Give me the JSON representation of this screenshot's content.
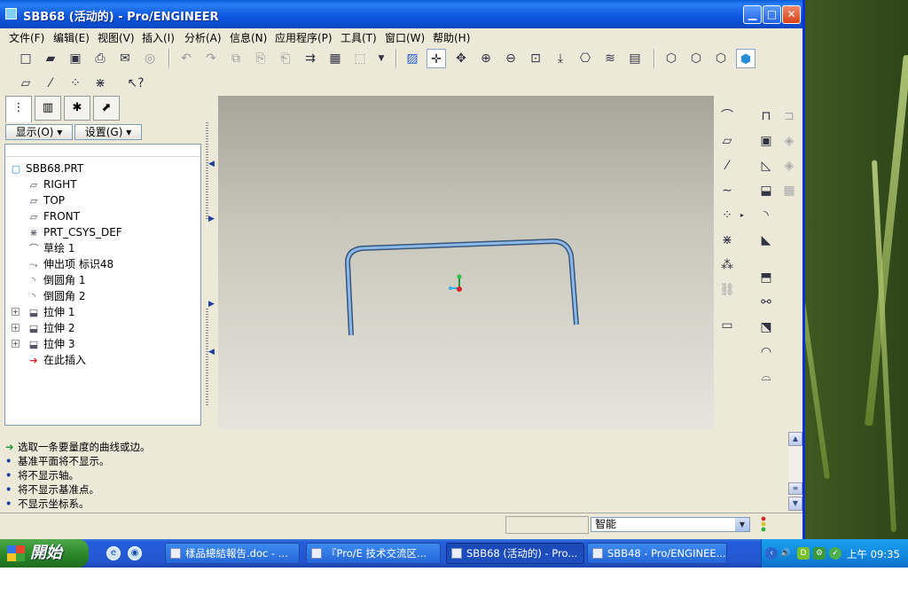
{
  "window": {
    "title": "SBB68 (活动的) - Pro/ENGINEER",
    "minimize": "▁",
    "maximize": "□",
    "close": "✕"
  },
  "menu": [
    "文件(F)",
    "编辑(E)",
    "视图(V)",
    "插入(I)",
    "分析(A)",
    "信息(N)",
    "应用程序(P)",
    "工具(T)",
    "窗口(W)",
    "帮助(H)"
  ],
  "toolbar1_icons": [
    "new-icon",
    "open-icon",
    "save-icon",
    "print-icon",
    "send-icon",
    "disk-icon",
    "undo-icon",
    "redo-icon",
    "copy-icon",
    "paste-icon",
    "paste-special-icon",
    "regenerate-icon",
    "find-icon",
    "select-box-icon",
    "dropdown-icon",
    "repaint-icon",
    "spin-center-icon",
    "orient-icon",
    "zoom-in-icon",
    "zoom-out-icon",
    "refit-icon",
    "reorient-icon",
    "saved-views-icon",
    "layers-icon",
    "view-manager-icon",
    "wireframe-icon",
    "hidden-line-icon",
    "no-hidden-icon",
    "shading-icon"
  ],
  "toolbar2_icons": [
    "datum-plane-display-icon",
    "datum-axis-display-icon",
    "datum-point-display-icon",
    "csys-display-icon",
    "context-help-icon"
  ],
  "panel": {
    "show_btn": "显示(O)",
    "settings_btn": "设置(G)",
    "tree": [
      {
        "label": "SBB68.PRT",
        "icon": "part-icon",
        "expandable": false,
        "indent": 0
      },
      {
        "label": "RIGHT",
        "icon": "datum-plane-icon",
        "expandable": false,
        "indent": 1
      },
      {
        "label": "TOP",
        "icon": "datum-plane-icon",
        "expandable": false,
        "indent": 1
      },
      {
        "label": "FRONT",
        "icon": "datum-plane-icon",
        "expandable": false,
        "indent": 1
      },
      {
        "label": "PRT_CSYS_DEF",
        "icon": "csys-icon",
        "expandable": false,
        "indent": 1
      },
      {
        "label": "草绘 1",
        "icon": "sketch-icon",
        "expandable": false,
        "indent": 1
      },
      {
        "label": "伸出项 标识48",
        "icon": "protrusion-icon",
        "expandable": false,
        "indent": 1
      },
      {
        "label": "倒圆角 1",
        "icon": "round-icon",
        "expandable": false,
        "indent": 1
      },
      {
        "label": "倒圆角 2",
        "icon": "round-icon",
        "expandable": false,
        "indent": 1
      },
      {
        "label": "拉伸 1",
        "icon": "extrude-icon",
        "expandable": true,
        "indent": 1
      },
      {
        "label": "拉伸 2",
        "icon": "extrude-icon",
        "expandable": true,
        "indent": 1
      },
      {
        "label": "拉伸 3",
        "icon": "extrude-icon",
        "expandable": true,
        "indent": 1
      },
      {
        "label": "在此插入",
        "icon": "insert-here-icon",
        "expandable": false,
        "indent": 1
      }
    ]
  },
  "messages": [
    {
      "text": "选取一条要量度的曲线或边。",
      "kind": "prompt"
    },
    {
      "text": "基准平面将不显示。",
      "kind": "info"
    },
    {
      "text": "将不显示轴。",
      "kind": "info"
    },
    {
      "text": "将不显示基准点。",
      "kind": "info"
    },
    {
      "text": "不显示坐标系。",
      "kind": "info"
    }
  ],
  "status": {
    "filter": "智能"
  },
  "taskbar": {
    "start": "開始",
    "tasks": [
      {
        "label": "樣品總結報告.doc - ...",
        "active": false
      },
      {
        "label": "『Pro/E 技术交流区...",
        "active": false
      },
      {
        "label": "SBB68 (活动的) - Pro...",
        "active": true
      },
      {
        "label": "SBB48 - Pro/ENGINEE...",
        "active": false
      }
    ],
    "clock": "上午 09:35"
  }
}
